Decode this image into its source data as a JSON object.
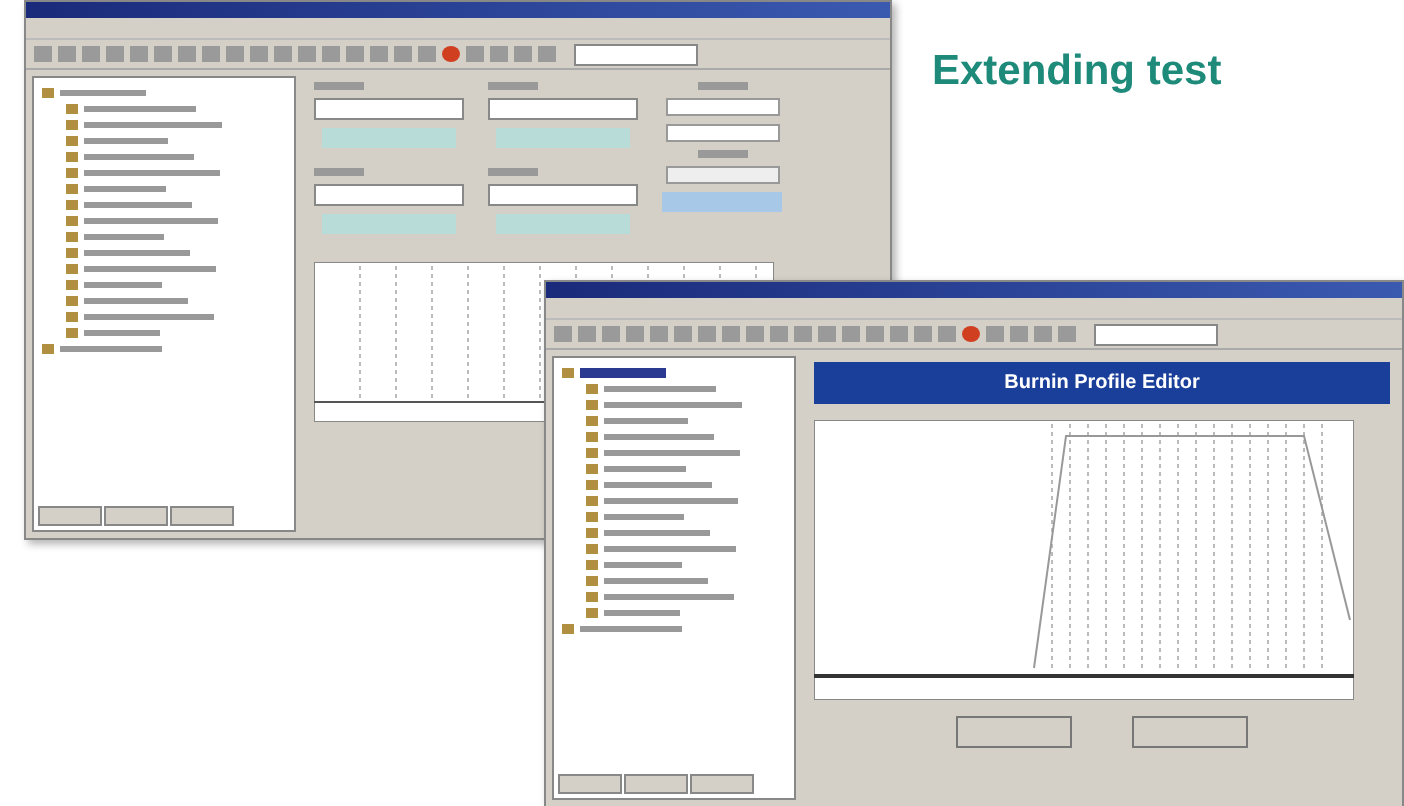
{
  "heading": "Extending test",
  "windows": [
    {
      "kind": "form",
      "root_selected": false
    },
    {
      "kind": "profile",
      "panel_title": "Burnin Profile Editor",
      "root_selected": true
    }
  ]
}
